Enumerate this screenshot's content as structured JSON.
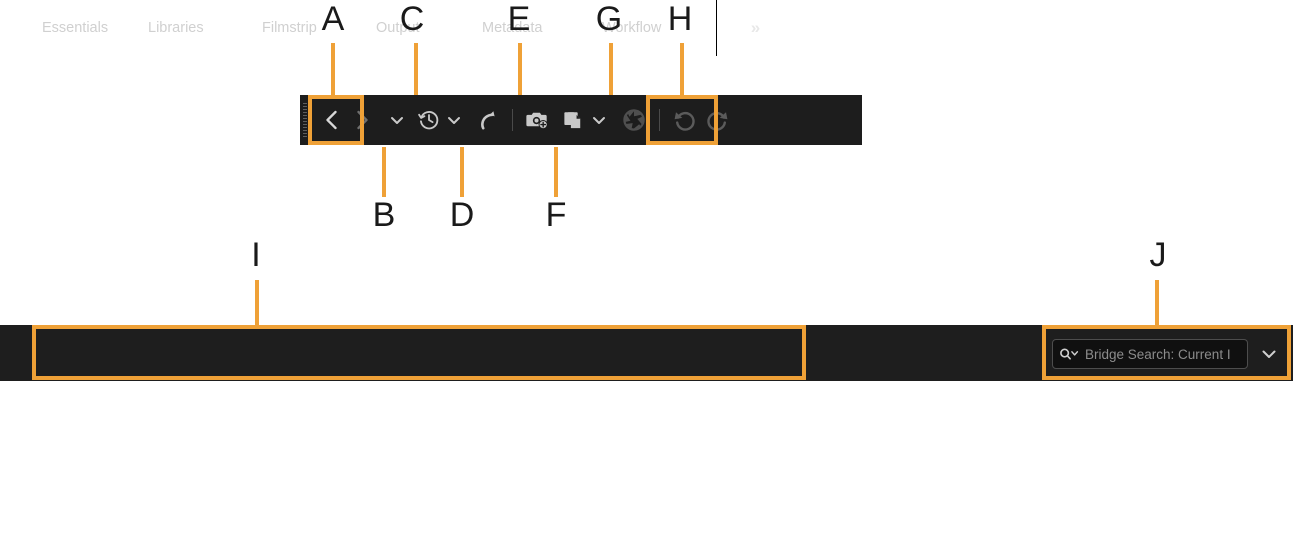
{
  "theme": {
    "highlight_color": "#efa137",
    "toolbar_bg": "#1d1d1d",
    "bar_bg": "#1e1e1e",
    "icon_color": "#c9c9c9",
    "icon_disabled_color": "#5b5b5b",
    "page_bg": "#ffffff"
  },
  "callouts": [
    {
      "letter": "A",
      "target": "back-forward-navigation-buttons"
    },
    {
      "letter": "B",
      "target": "navigation-history-dropdown"
    },
    {
      "letter": "C",
      "target": "recent-folders-clock-button"
    },
    {
      "letter": "D",
      "target": "go-to-parent-folder-button"
    },
    {
      "letter": "E",
      "target": "get-photos-from-camera-button"
    },
    {
      "letter": "F",
      "target": "refine-stack-button"
    },
    {
      "letter": "G",
      "target": "open-in-camera-raw-button"
    },
    {
      "letter": "H",
      "target": "rotate-buttons"
    },
    {
      "letter": "I",
      "target": "workspace-tabs"
    },
    {
      "letter": "J",
      "target": "bridge-search-box"
    }
  ],
  "toolbar": {
    "grip_label": "toolbar-drag-handle",
    "buttons": [
      {
        "name": "back-button",
        "icon": "chevron-left-icon",
        "enabled": true
      },
      {
        "name": "forward-button",
        "icon": "chevron-right-icon",
        "enabled": false
      },
      {
        "name": "navigation-history-dropdown",
        "icon": "chevron-down-icon",
        "enabled": true
      },
      {
        "name": "recent-folders-button",
        "icon": "clock-history-icon",
        "enabled": true
      },
      {
        "name": "recent-folders-dropdown",
        "icon": "chevron-down-icon",
        "enabled": true
      },
      {
        "name": "go-to-parent-folder-button",
        "icon": "boomerang-arrow-icon",
        "enabled": true
      },
      {
        "name": "get-photos-from-camera-button",
        "icon": "camera-plus-icon",
        "enabled": true
      },
      {
        "name": "refine-button",
        "icon": "stacked-pages-icon",
        "enabled": true
      },
      {
        "name": "refine-dropdown",
        "icon": "chevron-down-icon",
        "enabled": true
      },
      {
        "name": "open-in-camera-raw-button",
        "icon": "aperture-icon",
        "enabled": false
      },
      {
        "name": "rotate-counterclockwise-button",
        "icon": "rotate-left-icon",
        "enabled": false
      },
      {
        "name": "rotate-clockwise-button",
        "icon": "rotate-right-icon",
        "enabled": false
      }
    ]
  },
  "workspace": {
    "tabs": [
      {
        "label": "Essentials",
        "selected": false
      },
      {
        "label": "Libraries",
        "selected": false
      },
      {
        "label": "Filmstrip",
        "selected": false
      },
      {
        "label": "Output",
        "selected": false
      },
      {
        "label": "Metadata",
        "selected": false
      },
      {
        "label": "Workflow",
        "selected": false
      }
    ],
    "overflow_label": "»"
  },
  "search": {
    "icon": "search-icon",
    "placeholder": "Bridge Search: Current I",
    "value": "",
    "dropdown_icon": "chevron-down-icon"
  }
}
